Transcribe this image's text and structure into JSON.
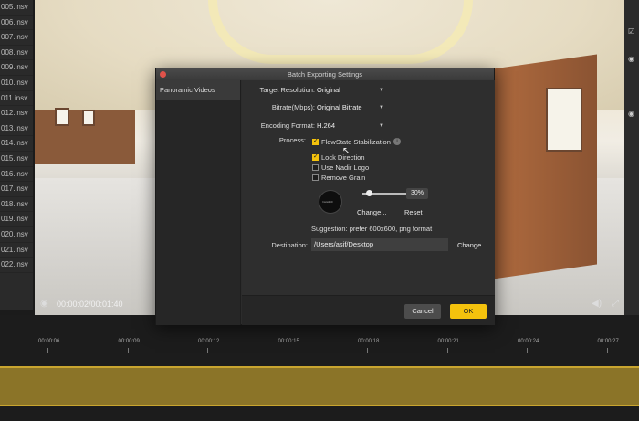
{
  "files": [
    "005.insv",
    "006.insv",
    "007.insv",
    "008.insv",
    "009.insv",
    "010.insv",
    "011.insv",
    "012.insv",
    "013.insv",
    "014.insv",
    "015.insv",
    "016.insv",
    "017.insv",
    "018.insv",
    "019.insv",
    "020.insv",
    "021.insv",
    "022.insv"
  ],
  "preview": {
    "time": "00:00:02/00:01:40"
  },
  "timeline": {
    "ticks": [
      "00:00:06",
      "00:00:09",
      "00:00:12",
      "00:00:15",
      "00:00:18",
      "00:00:21",
      "00:00:24",
      "00:00:27"
    ]
  },
  "dialog": {
    "title": "Batch Exporting Settings",
    "sidebar_item": "Panoramic Videos",
    "target_resolution": {
      "label": "Target Resolution:",
      "value": "Original"
    },
    "bitrate": {
      "label": "Bitrate(Mbps):",
      "value": "Original Bitrate"
    },
    "encoding_format": {
      "label": "Encoding Format:",
      "value": "H.264"
    },
    "process": {
      "label": "Process:",
      "options": [
        {
          "label": "FlowState Stabilization",
          "checked": true
        },
        {
          "label": "Lock Direction",
          "checked": true
        },
        {
          "label": "Use Nadir Logo",
          "checked": false
        },
        {
          "label": "Remove Grain",
          "checked": false
        }
      ]
    },
    "logo": {
      "text": "Insta360",
      "size_percent": "30%",
      "change": "Change...",
      "reset": "Reset"
    },
    "suggestion": "Suggestion: prefer 600x600, png format",
    "destination": {
      "label": "Destination:",
      "value": "/Users/asif/Desktop",
      "change": "Change..."
    },
    "buttons": {
      "cancel": "Cancel",
      "ok": "OK"
    }
  },
  "colors": {
    "accent": "#f4c20d",
    "track": "#8b7428"
  }
}
